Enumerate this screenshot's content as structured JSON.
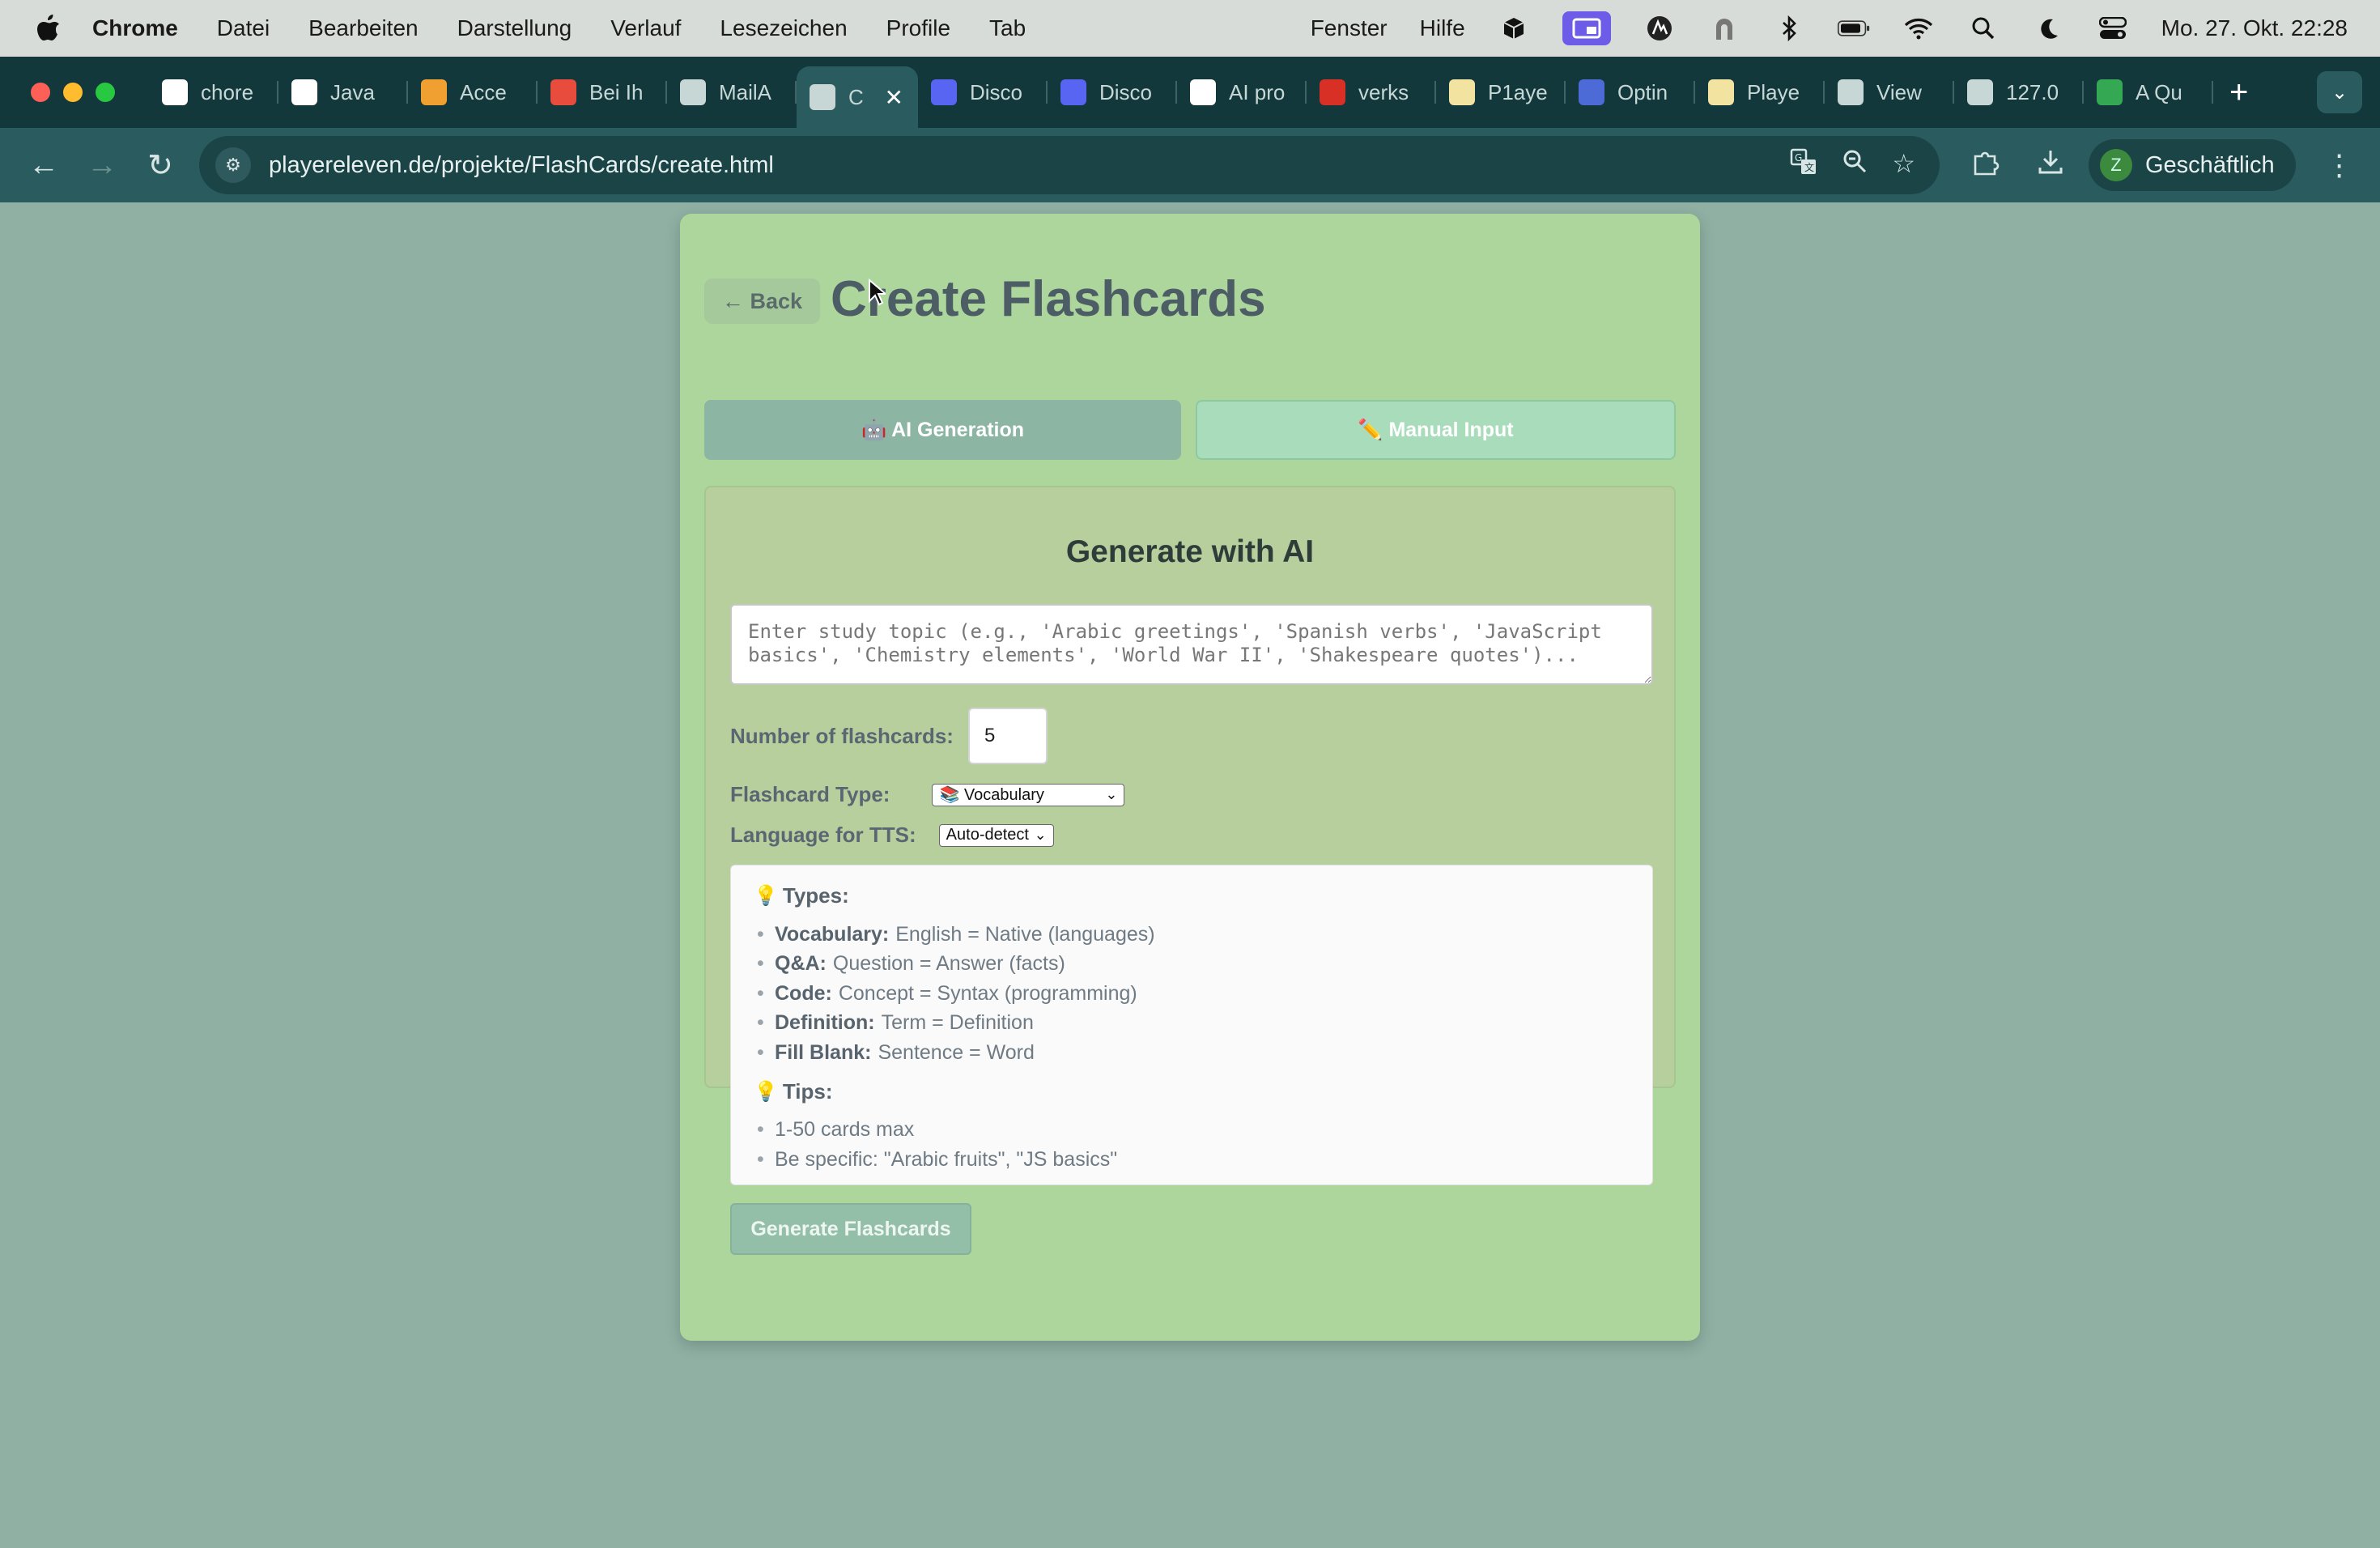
{
  "menubar": {
    "app": "Chrome",
    "items": [
      "Datei",
      "Bearbeiten",
      "Darstellung",
      "Verlauf",
      "Lesezeichen",
      "Profile",
      "Tab"
    ],
    "right_items": [
      "Fenster",
      "Hilfe"
    ],
    "datetime": "Mo. 27. Okt. 22:28"
  },
  "tabs": [
    {
      "label": "chore",
      "icon": "github-icon",
      "color": "#ffffff"
    },
    {
      "label": "Java",
      "icon": "openai-icon",
      "color": "#ffffff"
    },
    {
      "label": "Acce",
      "icon": "auth-icon",
      "color": "#f0a030"
    },
    {
      "label": "Bei Ih",
      "icon": "microsoft-icon",
      "color": "#e74c3c"
    },
    {
      "label": "MailA",
      "icon": "globe-icon",
      "color": "#c7d7d6"
    },
    {
      "label": "C",
      "icon": "globe-icon",
      "color": "#c7d7d6",
      "active": true
    },
    {
      "label": "Disco",
      "icon": "discord-icon",
      "color": "#5865f2"
    },
    {
      "label": "Disco",
      "icon": "discord-icon",
      "color": "#5865f2"
    },
    {
      "label": "AI pro",
      "icon": "openai-icon",
      "color": "#ffffff"
    },
    {
      "label": "verks",
      "icon": "pdf-icon",
      "color": "#d93025"
    },
    {
      "label": "P1aye",
      "icon": "page-icon",
      "color": "#f3e3a0"
    },
    {
      "label": "Optin",
      "icon": "check-icon",
      "color": "#4d6bd6"
    },
    {
      "label": "Playe",
      "icon": "page-icon",
      "color": "#f3e3a0"
    },
    {
      "label": "View",
      "icon": "globe-icon",
      "color": "#c7d7d6"
    },
    {
      "label": "127.0",
      "icon": "globe-icon",
      "color": "#c7d7d6"
    },
    {
      "label": "A Qu",
      "icon": "drive-icon",
      "color": "#34a853"
    }
  ],
  "toolbar": {
    "url": "playereleven.de/projekte/FlashCards/create.html",
    "profile_initial": "Z",
    "profile_name": "Geschäftlich"
  },
  "page": {
    "back_label": "← Back",
    "title": "Create Flashcards",
    "mode_ai": "🤖 AI Generation",
    "mode_manual": "✏️ Manual Input",
    "panel_title": "Generate with AI",
    "topic_placeholder": "Enter study topic (e.g., 'Arabic greetings', 'Spanish verbs', 'JavaScript basics', 'Chemistry elements', 'World War II', 'Shakespeare quotes')...",
    "num_label": "Number of flashcards:",
    "num_value": "5",
    "type_label": "Flashcard Type:",
    "type_value": "📚 Vocabulary",
    "lang_label": "Language for TTS:",
    "lang_value": "Auto-detect",
    "types_heading": "Types:",
    "types": [
      {
        "name": "Vocabulary:",
        "desc": "English = Native (languages)"
      },
      {
        "name": "Q&A:",
        "desc": "Question = Answer (facts)"
      },
      {
        "name": "Code:",
        "desc": "Concept = Syntax (programming)"
      },
      {
        "name": "Definition:",
        "desc": "Term = Definition"
      },
      {
        "name": "Fill Blank:",
        "desc": "Sentence = Word"
      }
    ],
    "tips_heading": "Tips:",
    "tips": [
      "1-50 cards max",
      "Be specific: \"Arabic fruits\", \"JS basics\""
    ],
    "generate_label": "Generate Flashcards"
  }
}
